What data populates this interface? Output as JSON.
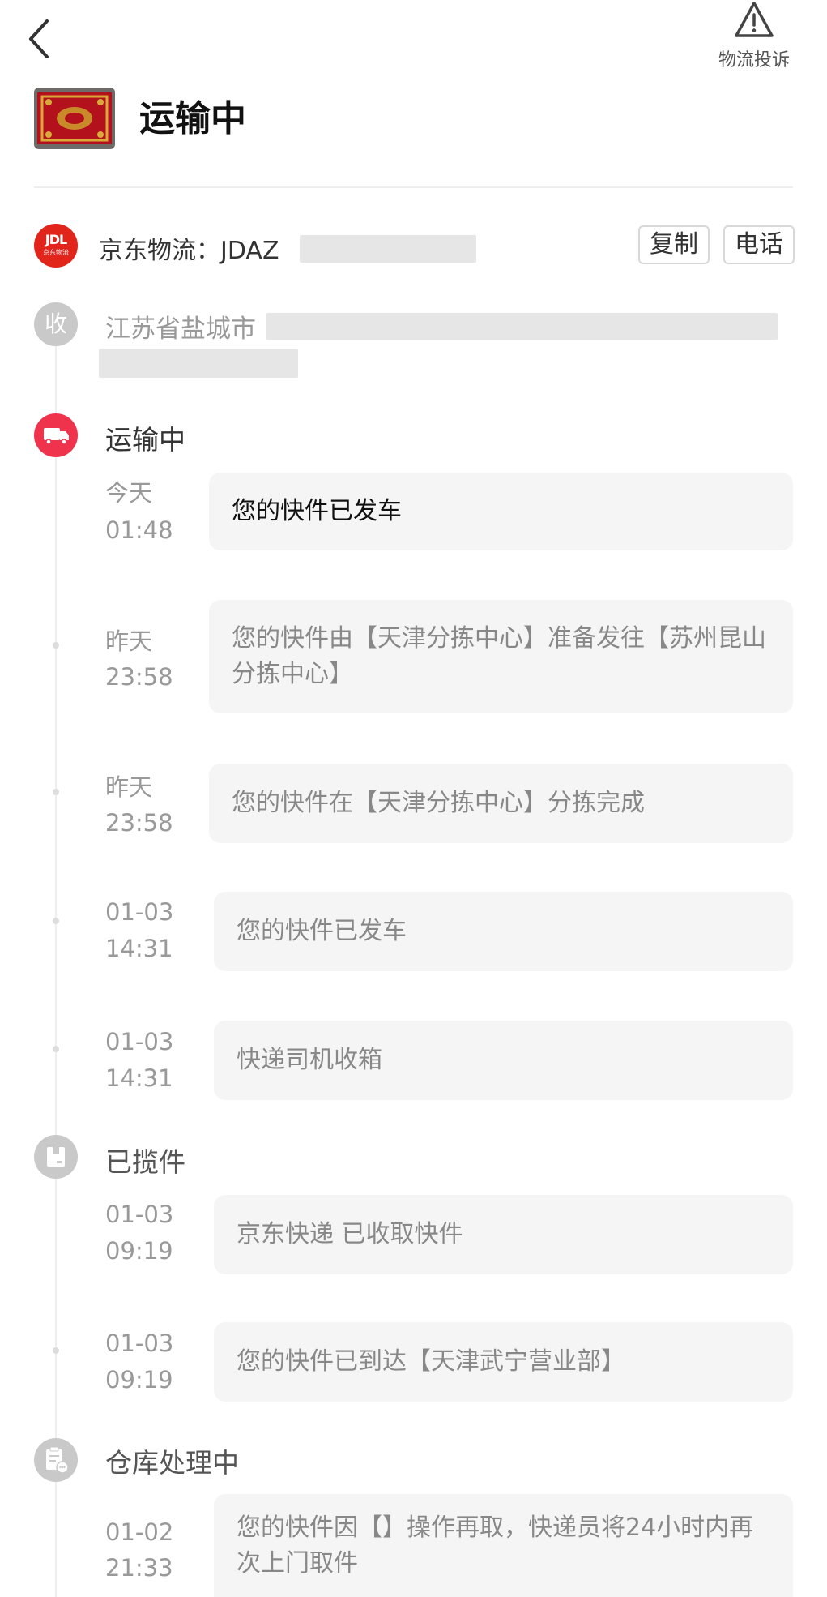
{
  "header": {
    "back_icon": "chevron-left-icon",
    "complaint_icon": "warning-triangle-icon",
    "complaint_label": "物流投诉"
  },
  "order": {
    "status_title": "运输中"
  },
  "carrier": {
    "logo_text": "JDL",
    "logo_sub": "京东物流",
    "label": "京东物流：JDAZ",
    "copy_button": "复制",
    "phone_button": "电话"
  },
  "address": {
    "node_label": "收",
    "text": "江苏省盐城市"
  },
  "sections": [
    {
      "title": "运输中",
      "icon": "truck-icon",
      "events": [
        {
          "day": "今天",
          "time": "01:48",
          "text": "您的快件已发车"
        },
        {
          "day": "昨天",
          "time": "23:58",
          "text": "您的快件由【天津分拣中心】准备发往【苏州昆山分拣中心】"
        },
        {
          "day": "昨天",
          "time": "23:58",
          "text": "您的快件在【天津分拣中心】分拣完成"
        },
        {
          "day": "01-03",
          "time": "14:31",
          "text": "您的快件已发车"
        },
        {
          "day": "01-03",
          "time": "14:31",
          "text": "快递司机收箱"
        }
      ]
    },
    {
      "title": "已揽件",
      "icon": "package-icon",
      "events": [
        {
          "day": "01-03",
          "time": "09:19",
          "text": "京东快递 已收取快件"
        },
        {
          "day": "01-03",
          "time": "09:19",
          "text": "您的快件已到达【天津武宁营业部】"
        }
      ]
    },
    {
      "title": "仓库处理中",
      "icon": "warehouse-clipboard-icon",
      "events": [
        {
          "day": "01-02",
          "time": "21:33",
          "text": "您的快件因【】操作再取，快递员将24小时内再次上门取件"
        }
      ]
    }
  ]
}
